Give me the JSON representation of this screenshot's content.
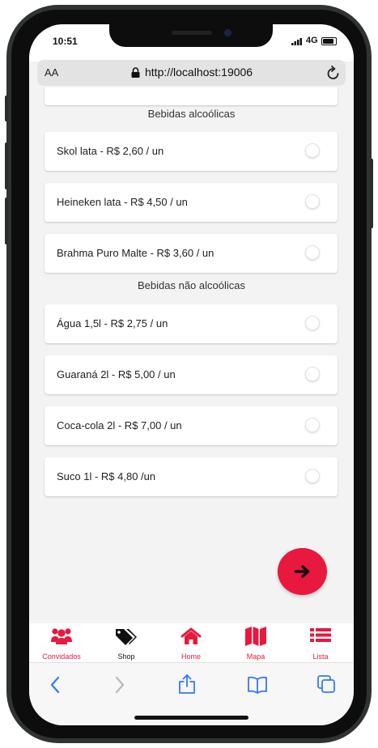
{
  "status_bar": {
    "time": "10:51",
    "network": "4G"
  },
  "browser": {
    "text_size": "AA",
    "url": "http://localhost:19006"
  },
  "sections": [
    {
      "title": "Bebidas alcoólicas",
      "items": [
        {
          "label": "Skol lata - R$ 2,60 / un",
          "checked": false
        },
        {
          "label": "Heineken lata - R$ 4,50 / un",
          "checked": false
        },
        {
          "label": "Brahma Puro Malte - R$ 3,60 / un",
          "checked": false
        }
      ]
    },
    {
      "title": "Bebidas não alcoólicas",
      "items": [
        {
          "label": "Água 1,5l - R$ 2,75 / un",
          "checked": false
        },
        {
          "label": "Guaraná 2l - R$ 5,00 / un",
          "checked": false
        },
        {
          "label": "Coca-cola 2l - R$ 7,00 / un",
          "checked": false
        },
        {
          "label": "Suco 1l - R$ 4,80 /un",
          "checked": false
        }
      ]
    }
  ],
  "tabs": [
    {
      "label": "Convidados",
      "icon": "users-icon",
      "color": "#e8183f"
    },
    {
      "label": "Shop",
      "icon": "tags-icon",
      "color": "#111111"
    },
    {
      "label": "Home",
      "icon": "home-icon",
      "color": "#e8183f"
    },
    {
      "label": "Mapa",
      "icon": "map-icon",
      "color": "#e8183f"
    },
    {
      "label": "Lista",
      "icon": "list-icon",
      "color": "#e8183f"
    }
  ],
  "colors": {
    "accent": "#e8183f",
    "ios_blue": "#3478f6"
  }
}
